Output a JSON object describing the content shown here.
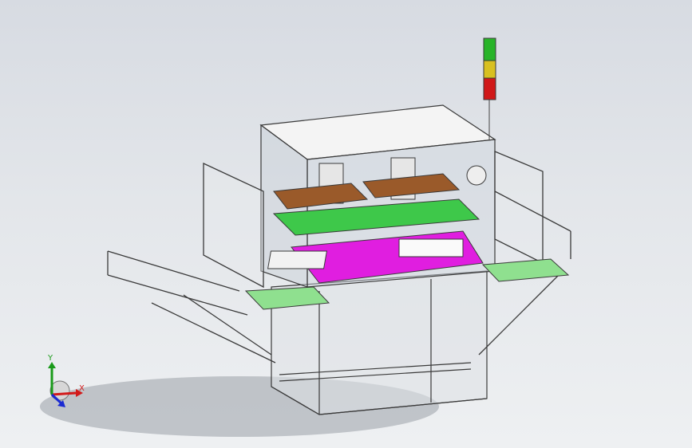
{
  "viewport": {
    "background_top": "#d7dbe2",
    "background_bottom": "#eef0f2"
  },
  "triad": {
    "x_label": "X",
    "y_label": "Y",
    "x_color": "#d21a1a",
    "y_color": "#1a9a1a",
    "z_color": "#1a2ad2"
  },
  "colors": {
    "frame_line": "#3a3a3a",
    "top_cover": "#f4f4f4",
    "brown_plate": "#9a5a2a",
    "green_plate": "#3ec84a",
    "magenta_plate": "#e01ee0",
    "tray_green": "#8fe08f",
    "signal_red": "#d01818",
    "signal_yellow": "#d8c020",
    "signal_green": "#28b428"
  }
}
